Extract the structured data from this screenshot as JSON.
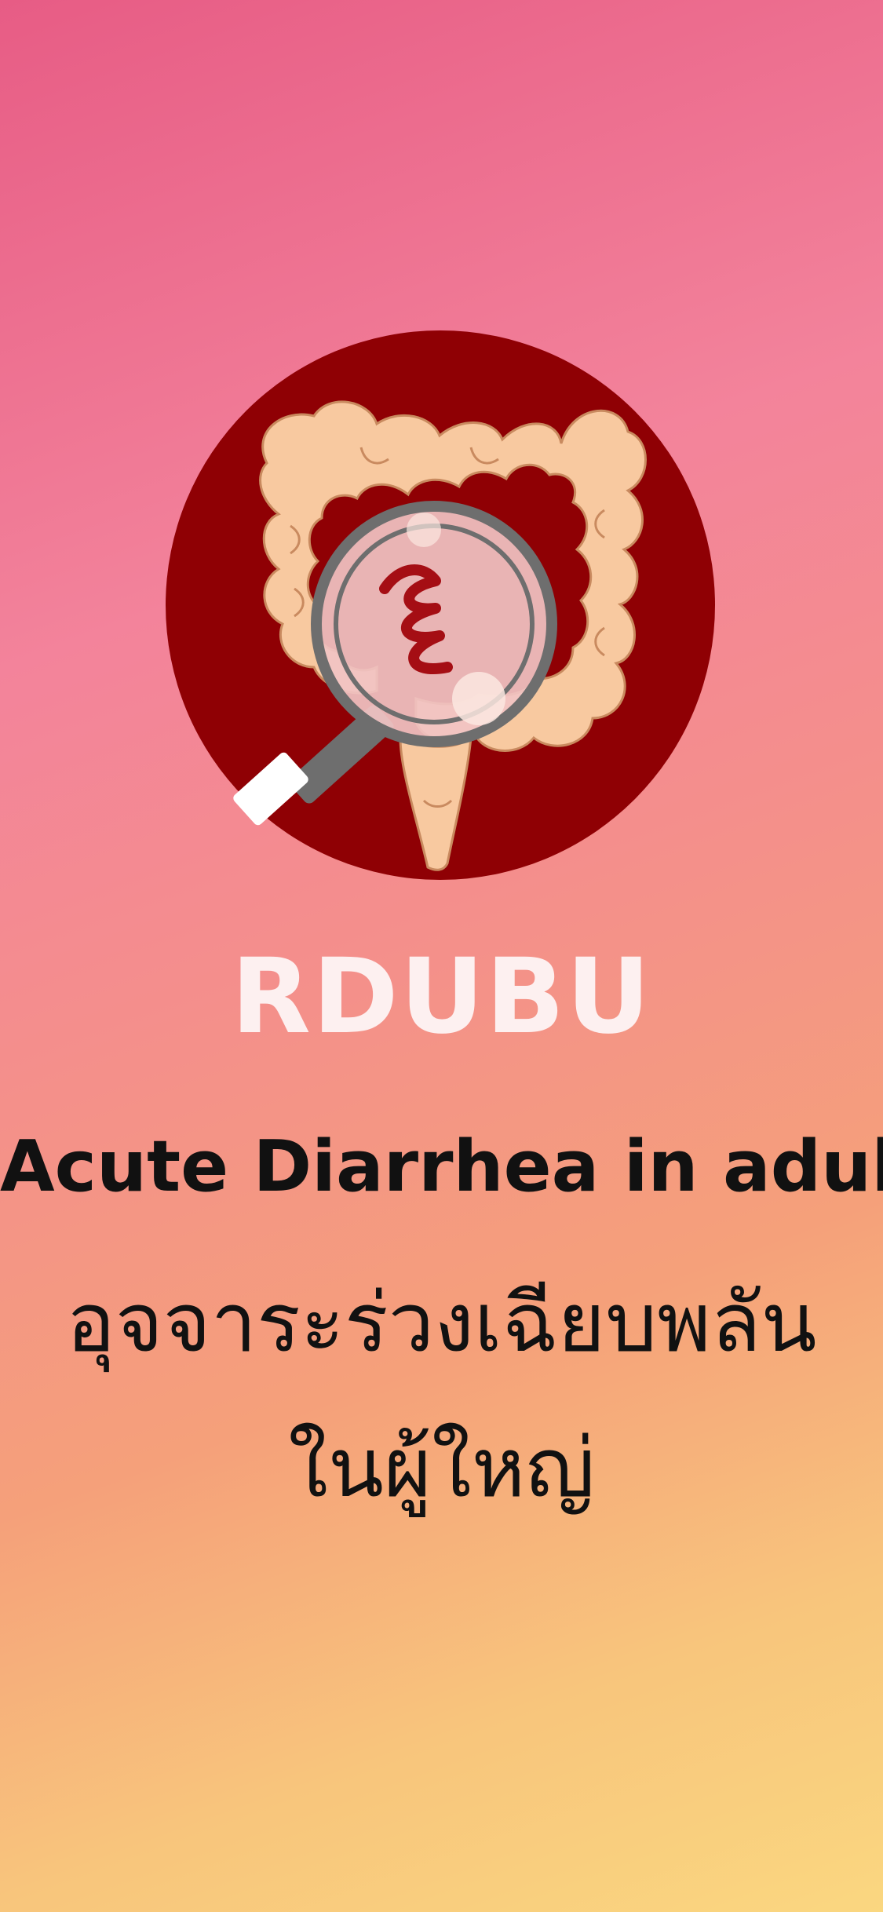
{
  "app": {
    "name": "RDUBU",
    "subtitle_en": "Acute Diarrhea in adult",
    "subtitle_th_line1": "อุจจาระร่วงเฉียบพลัน",
    "subtitle_th_line2": "ในผู้ใหญ่"
  },
  "logo": {
    "icon": "intestine-magnifier-icon",
    "circle_color": "#8f0004",
    "intestine_color": "#f8c9a0",
    "lens_color": "#f1c3c3",
    "lens_ring_color": "#6e6e6e",
    "squiggle_color": "#a50e14"
  },
  "colors": {
    "gradient_top": "#e75c85",
    "gradient_bottom": "#fad780",
    "title_color": "#fdf0f0",
    "text_color": "#111111"
  }
}
